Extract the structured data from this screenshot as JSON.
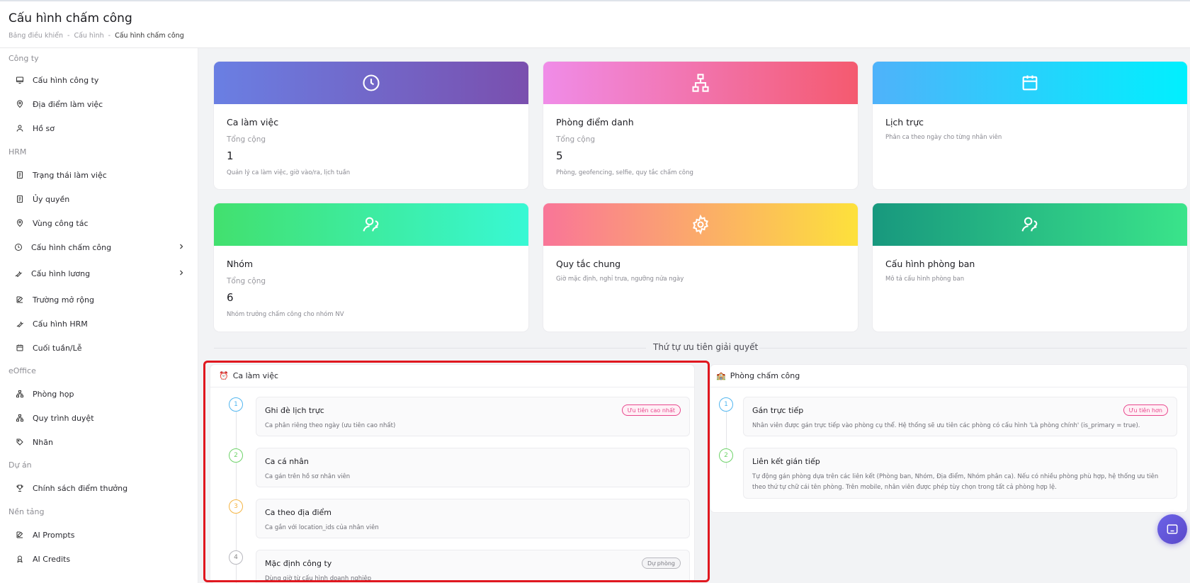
{
  "header": {
    "title": "Cấu hình chấm công",
    "breadcrumb": [
      "Bảng điều khiển",
      "Cấu hình",
      "Cấu hình chấm công"
    ],
    "separator": "-"
  },
  "sidebar": {
    "sections": [
      {
        "label": "Công ty"
      },
      {
        "label": "HRM"
      },
      {
        "label": "eOffice"
      },
      {
        "label": "Dự án"
      },
      {
        "label": "Nền tảng"
      }
    ],
    "items": [
      {
        "label": "Cấu hình công ty",
        "icon": "monitor-icon"
      },
      {
        "label": "Địa điểm làm việc",
        "icon": "location-pin-icon"
      },
      {
        "label": "Hồ sơ",
        "icon": "user-icon"
      },
      {
        "label": "Trạng thái làm việc",
        "icon": "document-icon"
      },
      {
        "label": "Ủy quyền",
        "icon": "document-icon"
      },
      {
        "label": "Vùng công tác",
        "icon": "location-pin-icon"
      },
      {
        "label": "Cấu hình chấm công",
        "icon": "clock-icon"
      },
      {
        "label": "Cấu hình lương",
        "icon": "wrench-icon"
      },
      {
        "label": "Trường mở rộng",
        "icon": "edit-icon"
      },
      {
        "label": "Cấu hình HRM",
        "icon": "wrench-icon"
      },
      {
        "label": "Cuối tuần/Lễ",
        "icon": "calendar-icon"
      },
      {
        "label": "Phòng họp",
        "icon": "network-icon"
      },
      {
        "label": "Quy trình duyệt",
        "icon": "network-icon"
      },
      {
        "label": "Nhãn",
        "icon": "tag-icon"
      },
      {
        "label": "Chính sách điểm thưởng",
        "icon": "trophy-icon"
      },
      {
        "label": "AI Prompts",
        "icon": "edit-icon"
      },
      {
        "label": "AI Credits",
        "icon": "award-icon"
      }
    ]
  },
  "cards": [
    {
      "title": "Ca làm việc",
      "sub": "Tổng cộng",
      "count": "1",
      "desc": "Quản lý ca làm việc, giờ vào/ra, lịch tuần",
      "icon": "clock-icon",
      "gradient": [
        "#6a7fe3",
        "#7a4fae"
      ]
    },
    {
      "title": "Phòng điểm danh",
      "sub": "Tổng cộng",
      "count": "5",
      "desc": "Phòng, geofencing, selfie, quy tắc chấm công",
      "icon": "sitemap-icon",
      "gradient": [
        "#f08ce8",
        "#f45a6f"
      ]
    },
    {
      "title": "Lịch trực",
      "desc": "Phân ca theo ngày cho từng nhân viên",
      "icon": "calendar-icon",
      "gradient": [
        "#4fb2fa",
        "#00f0fe"
      ]
    },
    {
      "title": "Nhóm",
      "sub": "Tổng cộng",
      "count": "6",
      "desc": "Nhóm trưởng chấm công cho nhóm NV",
      "icon": "users-icon",
      "gradient": [
        "#42e06e",
        "#38f8d4"
      ]
    },
    {
      "title": "Quy tắc chung",
      "desc": "Giờ mặc định, nghỉ trưa, ngưỡng nửa ngày",
      "icon": "gear-icon",
      "gradient": [
        "#f97598",
        "#fde13b"
      ]
    },
    {
      "title": "Cấu hình phòng ban",
      "desc": "Mô tả cấu hình phòng ban",
      "icon": "users-icon",
      "gradient": [
        "#18987e",
        "#3ae48a"
      ]
    }
  ],
  "priority": {
    "title": "Thứ tự ưu tiên giải quyết",
    "left": {
      "heading": "Ca làm việc",
      "emoji": "⏰",
      "steps": [
        {
          "n": "1",
          "title": "Ghi đè lịch trực",
          "desc": "Ca phân riêng theo ngày (ưu tiên cao nhất)",
          "badge": "Ưu tiên cao nhất",
          "color": "#52b6ef"
        },
        {
          "n": "2",
          "title": "Ca cá nhân",
          "desc": "Ca gán trên hồ sơ nhân viên",
          "color": "#6fd36a"
        },
        {
          "n": "3",
          "title": "Ca theo địa điểm",
          "desc": "Ca gắn với location_ids của nhân viên",
          "color": "#f5b544"
        },
        {
          "n": "4",
          "title": "Mặc định công ty",
          "desc": "Dùng giờ từ cấu hình doanh nghiệp",
          "badge": "Dự phòng",
          "color": "#b8b8be"
        }
      ]
    },
    "right": {
      "heading": "Phòng chấm công",
      "emoji": "🏫",
      "steps": [
        {
          "n": "1",
          "title": "Gán trực tiếp",
          "desc": "Nhân viên được gán trực tiếp vào phòng cụ thể. Hệ thống sẽ ưu tiên các phòng có cấu hình 'Là phòng chính' (is_primary = true).",
          "badge": "Ưu tiên hơn",
          "color": "#52b6ef"
        },
        {
          "n": "2",
          "title": "Liên kết gián tiếp",
          "desc": "Tự động gán phòng dựa trên các liên kết (Phòng ban, Nhóm, Địa điểm, Nhóm phân ca). Nếu có nhiều phòng phù hợp, hệ thống ưu tiên theo thứ tự chữ cái tên phòng. Trên mobile, nhân viên được phép tùy chọn trong tất cả phòng hợp lệ.",
          "color": "#6fd36a"
        }
      ]
    }
  },
  "colors": {
    "badge_pink": "#e8478d",
    "badge_gray": "#7a7a82",
    "highlight": "#e0171f"
  }
}
